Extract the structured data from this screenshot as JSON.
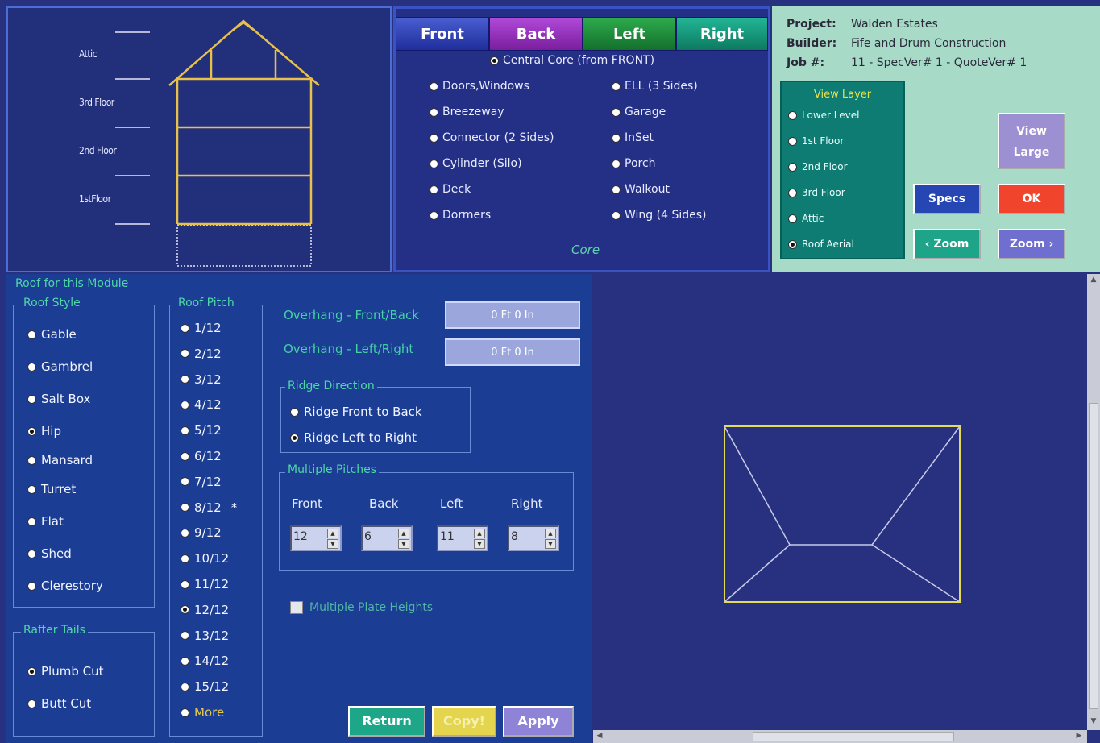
{
  "elevation": {
    "floors": [
      "Attic",
      "3rd Floor",
      "2nd Floor",
      "1stFloor"
    ]
  },
  "module_tabs": [
    {
      "label": "Front",
      "color": "#2d3fae"
    },
    {
      "label": "Back",
      "color": "#8f2bb5"
    },
    {
      "label": "Left",
      "color": "#1f8a3c"
    },
    {
      "label": "Right",
      "color": "#129679"
    }
  ],
  "modules": {
    "central": "Central Core (from FRONT)",
    "left_column": [
      "Doors,Windows",
      "Breezeway",
      "Connector (2 Sides)",
      "Cylinder (Silo)",
      "Deck",
      "Dormers"
    ],
    "right_column": [
      "ELL (3 Sides)",
      "Garage",
      "InSet",
      "Porch",
      "Walkout",
      "Wing (4 Sides)"
    ],
    "footer": "Core"
  },
  "project": {
    "project_key": "Project:",
    "project_value": "Walden Estates",
    "builder_key": "Builder:",
    "builder_value": "Fife and Drum Construction",
    "job_key": "Job #:",
    "job_value": "11 - SpecVer# 1 - QuoteVer# 1"
  },
  "view_layer": {
    "title": "View Layer",
    "items": [
      "Lower Level",
      "1st Floor",
      "2nd Floor",
      "3rd Floor",
      "Attic",
      "Roof Aerial"
    ],
    "selected": 5
  },
  "buttons": {
    "view_large": "View Large",
    "specs": "Specs",
    "ok": "OK",
    "zoom_in": "‹ Zoom",
    "zoom_out": "Zoom ›",
    "return": "Return",
    "copy": "Copy!",
    "apply": "Apply"
  },
  "roof": {
    "title": "Roof for this Module",
    "style_title": "Roof Style",
    "styles": [
      "Gable",
      "Gambrel",
      "Salt Box",
      "Hip",
      "Mansard",
      "Turret",
      "Flat",
      "Shed",
      "Clerestory"
    ],
    "style_selected": 3,
    "pitch_title": "Roof Pitch",
    "pitches": [
      "1/12",
      "2/12",
      "3/12",
      "4/12",
      "5/12",
      "6/12",
      "7/12",
      "8/12",
      "9/12",
      "10/12",
      "11/12",
      "12/12",
      "13/12",
      "14/12",
      "15/12",
      "More"
    ],
    "pitch_selected": 11,
    "pitch_marker": "*",
    "rafter_title": "Rafter Tails",
    "rafters": [
      "Plumb Cut",
      "Butt Cut"
    ],
    "rafter_selected": 0,
    "overhang_fb_label": "Overhang - Front/Back",
    "overhang_fb_value": "0 Ft 0 In",
    "overhang_lr_label": "Overhang - Left/Right",
    "overhang_lr_value": "0 Ft 0 In",
    "ridge_title": "Ridge Direction",
    "ridges": [
      "Ridge Front to Back",
      "Ridge Left to Right"
    ],
    "ridge_selected": 1,
    "multi_title": "Multiple Pitches",
    "multi": [
      {
        "label": "Front",
        "value": "12"
      },
      {
        "label": "Back",
        "value": "6"
      },
      {
        "label": "Left",
        "value": "11"
      },
      {
        "label": "Right",
        "value": "8"
      }
    ],
    "plate_label": "Multiple Plate Heights"
  }
}
